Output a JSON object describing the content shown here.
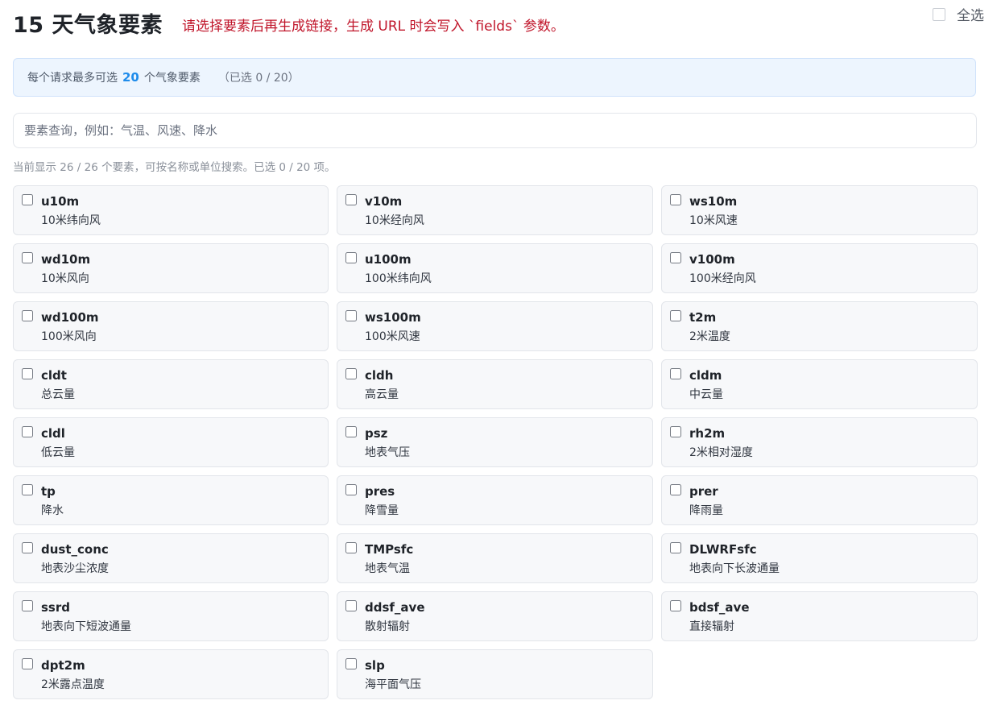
{
  "header": {
    "title": "15 天气象要素",
    "hint": "请选择要素后再生成链接，生成 URL 时会写入 `fields` 参数。",
    "select_all_label": "全选"
  },
  "info": {
    "prefix": "每个请求最多可选",
    "limit": "20",
    "suffix": "个气象要素",
    "selected": "（已选 0 / 20）"
  },
  "search": {
    "placeholder": "要素查询，例如：气温、风速、降水",
    "value": ""
  },
  "stats": "当前显示 26 / 26 个要素，可按名称或单位搜索。已选 0 / 20 项。",
  "elements": [
    {
      "code": "u10m",
      "desc": "10米纬向风",
      "checked": false
    },
    {
      "code": "v10m",
      "desc": "10米经向风",
      "checked": false
    },
    {
      "code": "ws10m",
      "desc": "10米风速",
      "checked": false
    },
    {
      "code": "wd10m",
      "desc": "10米风向",
      "checked": false
    },
    {
      "code": "u100m",
      "desc": "100米纬向风",
      "checked": false
    },
    {
      "code": "v100m",
      "desc": "100米经向风",
      "checked": false
    },
    {
      "code": "wd100m",
      "desc": "100米风向",
      "checked": false
    },
    {
      "code": "ws100m",
      "desc": "100米风速",
      "checked": false
    },
    {
      "code": "t2m",
      "desc": "2米温度",
      "checked": false
    },
    {
      "code": "cldt",
      "desc": "总云量",
      "checked": false
    },
    {
      "code": "cldh",
      "desc": "高云量",
      "checked": false
    },
    {
      "code": "cldm",
      "desc": "中云量",
      "checked": false
    },
    {
      "code": "cldl",
      "desc": "低云量",
      "checked": false
    },
    {
      "code": "psz",
      "desc": "地表气压",
      "checked": false
    },
    {
      "code": "rh2m",
      "desc": "2米相对湿度",
      "checked": false
    },
    {
      "code": "tp",
      "desc": "降水",
      "checked": false
    },
    {
      "code": "pres",
      "desc": "降雪量",
      "checked": false
    },
    {
      "code": "prer",
      "desc": "降雨量",
      "checked": false
    },
    {
      "code": "dust_conc",
      "desc": "地表沙尘浓度",
      "checked": false
    },
    {
      "code": "TMPsfc",
      "desc": "地表气温",
      "checked": false
    },
    {
      "code": "DLWRFsfc",
      "desc": "地表向下长波通量",
      "checked": false
    },
    {
      "code": "ssrd",
      "desc": "地表向下短波通量",
      "checked": false
    },
    {
      "code": "ddsf_ave",
      "desc": "散射辐射",
      "checked": false
    },
    {
      "code": "bdsf_ave",
      "desc": "直接辐射",
      "checked": false
    },
    {
      "code": "dpt2m",
      "desc": "2米露点温度",
      "checked": false
    },
    {
      "code": "slp",
      "desc": "海平面气压",
      "checked": false
    }
  ]
}
